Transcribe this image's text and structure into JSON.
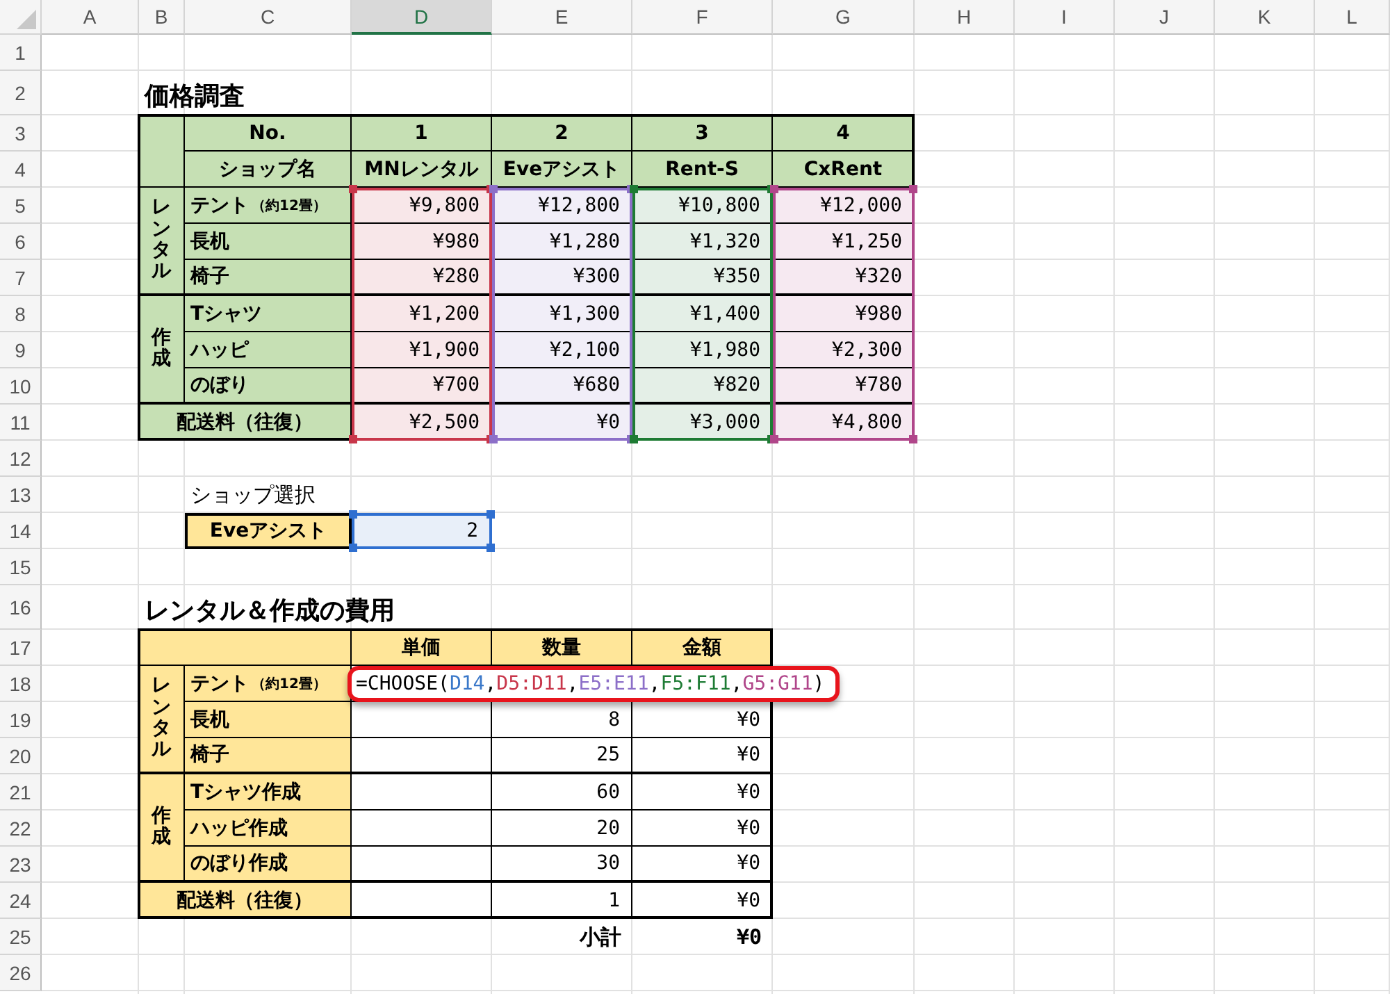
{
  "column_headers": [
    {
      "label": "A",
      "selected": false
    },
    {
      "label": "B",
      "selected": false
    },
    {
      "label": "C",
      "selected": false
    },
    {
      "label": "D",
      "selected": true
    },
    {
      "label": "E",
      "selected": false
    },
    {
      "label": "F",
      "selected": false
    },
    {
      "label": "G",
      "selected": false
    },
    {
      "label": "H",
      "selected": false
    },
    {
      "label": "I",
      "selected": false
    },
    {
      "label": "J",
      "selected": false
    },
    {
      "label": "K",
      "selected": false
    },
    {
      "label": "L",
      "selected": false
    }
  ],
  "row_headers": [
    "1",
    "2",
    "3",
    "4",
    "5",
    "6",
    "7",
    "8",
    "9",
    "10",
    "11",
    "12",
    "13",
    "14",
    "15",
    "16",
    "17",
    "18",
    "19",
    "20",
    "21",
    "22",
    "23",
    "24",
    "25",
    "26"
  ],
  "price_table": {
    "title": "価格調査",
    "no_label": "No.",
    "shop_label": "ショップ名",
    "shops": [
      {
        "no": "1",
        "name": "MNレンタル",
        "color": "#c8364a"
      },
      {
        "no": "2",
        "name": "Eveアシスト",
        "color": "#8c6fc8"
      },
      {
        "no": "3",
        "name": "Rent-S",
        "color": "#1e7b34"
      },
      {
        "no": "4",
        "name": "CxRent",
        "color": "#b0468a"
      }
    ],
    "groups": [
      {
        "label": "レンタル",
        "items": [
          {
            "name": "テント",
            "note": "（約12畳）",
            "prices": [
              "¥9,800",
              "¥12,800",
              "¥10,800",
              "¥12,000"
            ]
          },
          {
            "name": "長机",
            "prices": [
              "¥980",
              "¥1,280",
              "¥1,320",
              "¥1,250"
            ]
          },
          {
            "name": "椅子",
            "prices": [
              "¥280",
              "¥300",
              "¥350",
              "¥320"
            ]
          }
        ]
      },
      {
        "label": "作成",
        "items": [
          {
            "name": "Tシャツ",
            "prices": [
              "¥1,200",
              "¥1,300",
              "¥1,400",
              "¥980"
            ]
          },
          {
            "name": "ハッピ",
            "prices": [
              "¥1,900",
              "¥2,100",
              "¥1,980",
              "¥2,300"
            ]
          },
          {
            "name": "のぼり",
            "prices": [
              "¥700",
              "¥680",
              "¥820",
              "¥780"
            ]
          }
        ]
      }
    ],
    "shipping": {
      "label": "配送料（往復）",
      "prices": [
        "¥2,500",
        "¥0",
        "¥3,000",
        "¥4,800"
      ]
    }
  },
  "shop_selection": {
    "label": "ショップ選択",
    "shop_name": "Eveアシスト",
    "value": "2"
  },
  "cost_table": {
    "title": "レンタル＆作成の費用",
    "columns": [
      "単価",
      "数量",
      "金額"
    ],
    "groups": [
      {
        "label": "レンタル",
        "items": [
          {
            "name": "テント",
            "note": "（約12畳）"
          },
          {
            "name": "長机",
            "quantity": "8",
            "amount": "¥0"
          },
          {
            "name": "椅子",
            "quantity": "25",
            "amount": "¥0"
          }
        ]
      },
      {
        "label": "作成",
        "items": [
          {
            "name": "Tシャツ作成",
            "quantity": "60",
            "amount": "¥0"
          },
          {
            "name": "ハッピ作成",
            "quantity": "20",
            "amount": "¥0"
          },
          {
            "name": "のぼり作成",
            "quantity": "30",
            "amount": "¥0"
          }
        ]
      }
    ],
    "shipping": {
      "label": "配送料（往復）",
      "quantity": "1",
      "amount": "¥0"
    },
    "subtotal": {
      "label": "小計",
      "amount": "¥0"
    },
    "formula": [
      {
        "text": "=CHOOSE(",
        "color": "#000000"
      },
      {
        "text": "D14",
        "color": "#3a78c9"
      },
      {
        "text": ",",
        "color": "#000000"
      },
      {
        "text": "D5:D11",
        "color": "#c8364a"
      },
      {
        "text": ",",
        "color": "#000000"
      },
      {
        "text": "E5:E11",
        "color": "#8c6fc8"
      },
      {
        "text": ",",
        "color": "#000000"
      },
      {
        "text": "F5:F11",
        "color": "#1e7b34"
      },
      {
        "text": ",",
        "color": "#000000"
      },
      {
        "text": "G5:G11",
        "color": "#b0468a"
      },
      {
        "text": ")",
        "color": "#000000"
      }
    ]
  }
}
